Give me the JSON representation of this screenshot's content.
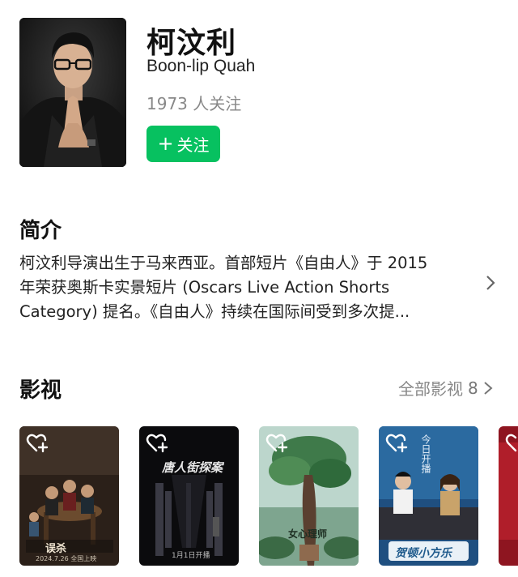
{
  "person": {
    "name": "柯汶利",
    "english_name": "Boon-lip Quah",
    "followers": "1973 人关注",
    "follow_label": "关注",
    "follow_plus": "+"
  },
  "intro": {
    "title": "简介",
    "lines": [
      "柯汶利导演出生于马来西亚。首部短片《自由人》于 2015",
      "年荣获奥斯卡实景短片 (Oscars Live Action Shorts",
      "Category) 提名。《自由人》持续在国际间受到多次提..."
    ]
  },
  "works": {
    "title": "影视",
    "all_label": "全部影视",
    "count": "8",
    "posters": [
      {
        "title": "误杀",
        "date": "2024.7.26 全国上映",
        "theme": "#3a2a1f"
      },
      {
        "title": "唐人街探案",
        "date": "1月1日开播",
        "theme": "#0c0c0e"
      },
      {
        "title": "女心理师",
        "date": "",
        "theme": "#8fb7a2"
      },
      {
        "title": "贺顿小方乐",
        "date": "今日开播",
        "theme": "#1d4a7a"
      },
      {
        "title": "",
        "date": "",
        "theme": "#b01e2a"
      }
    ]
  },
  "colors": {
    "accent": "#07c160",
    "muted": "#888888"
  }
}
